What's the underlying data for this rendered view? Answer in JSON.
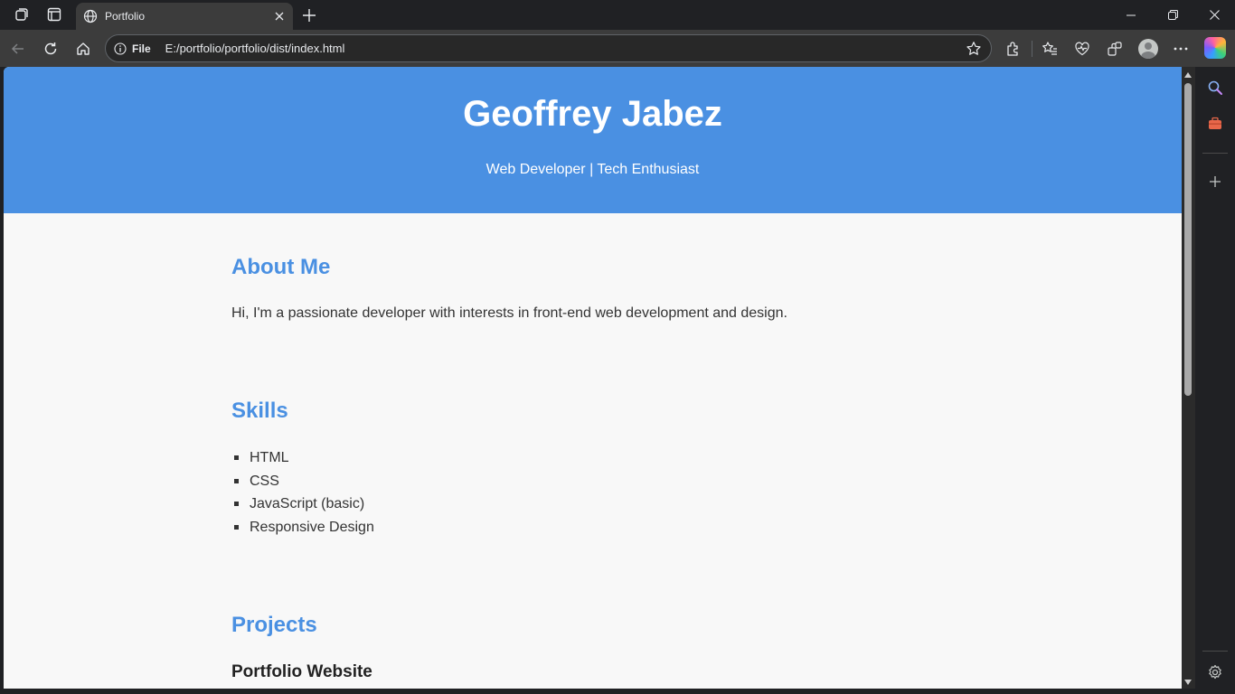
{
  "browser": {
    "tab": {
      "title": "Portfolio"
    },
    "address_bar": {
      "security_label": "File",
      "url": "E:/portfolio/portfolio/dist/index.html"
    }
  },
  "page": {
    "hero": {
      "name": "Geoffrey Jabez",
      "tagline": "Web Developer | Tech Enthusiast"
    },
    "about": {
      "title": "About Me",
      "text": "Hi, I'm a passionate developer with interests in front-end web development and design."
    },
    "skills": {
      "title": "Skills",
      "items": [
        "HTML",
        "CSS",
        "JavaScript (basic)",
        "Responsive Design"
      ]
    },
    "projects": {
      "title": "Projects",
      "first_project": "Portfolio Website"
    }
  },
  "colors": {
    "accent": "#4a90e2",
    "page_bg": "#f8f8f8",
    "text": "#333333"
  }
}
